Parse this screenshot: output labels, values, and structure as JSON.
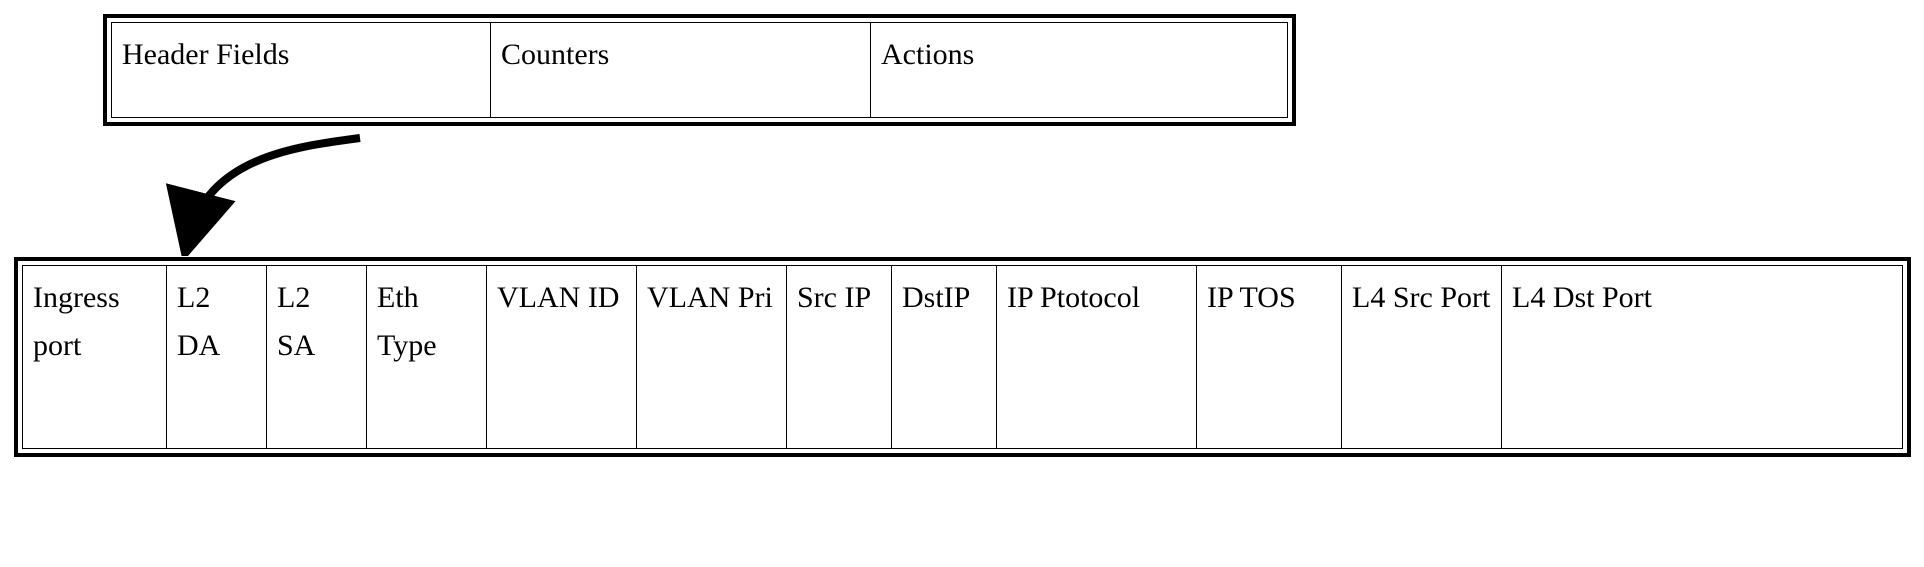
{
  "top_table": {
    "cells": [
      "Header Fields",
      "Counters",
      "Actions"
    ]
  },
  "bottom_table": {
    "cells": [
      "Ingress port",
      "L2 DA",
      "L2 SA",
      "Eth Type",
      "VLAN ID",
      "VLAN Pri",
      "Src IP",
      "DstIP",
      "IP Ptotocol",
      "IP TOS",
      "L4 Src Port",
      "L4 Dst Port"
    ]
  }
}
